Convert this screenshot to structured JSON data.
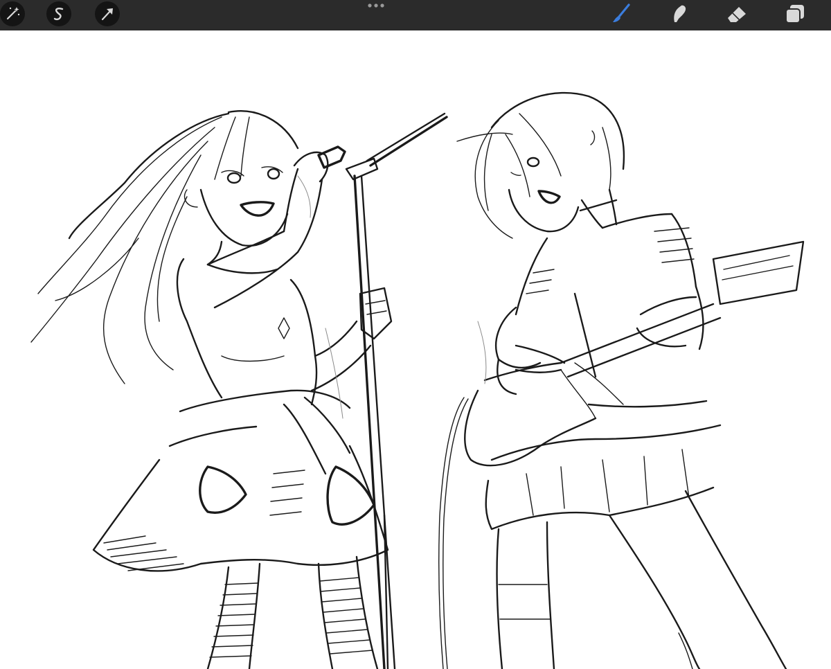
{
  "app": {
    "toolbar": {
      "left_tools": [
        {
          "icon": "adjustments-wand-icon"
        },
        {
          "icon": "selection-s-icon"
        },
        {
          "icon": "transform-arrow-icon"
        }
      ],
      "more_icon": "more-dots-icon",
      "right_tools": [
        {
          "icon": "brush-icon",
          "active": true
        },
        {
          "icon": "smudge-icon",
          "active": false
        },
        {
          "icon": "eraser-icon",
          "active": false
        },
        {
          "icon": "layers-icon",
          "active": false
        }
      ]
    },
    "colors": {
      "toolbar_bg": "#2b2b2b",
      "tool_circle_bg": "#141414",
      "icon": "#d9d9d9",
      "active_brush": "#3b7ddd",
      "canvas_bg": "#ffffff",
      "ink": "#1a1a1a"
    },
    "canvas": {
      "content": "sketch-of-two-musicians"
    }
  }
}
